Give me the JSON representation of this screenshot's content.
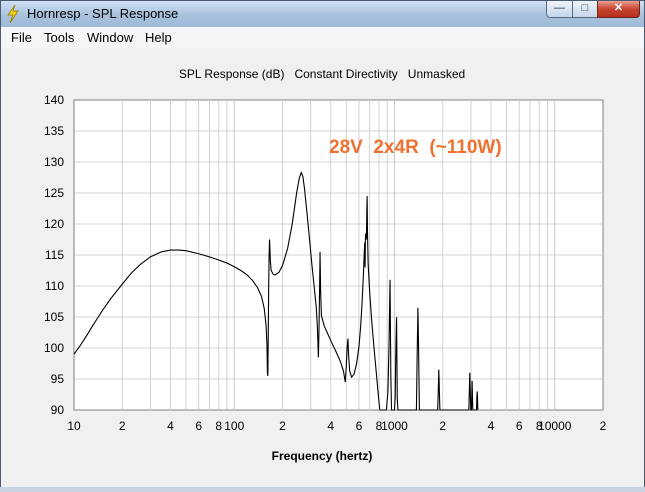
{
  "window": {
    "title": "Hornresp - SPL Response",
    "icon": "lightning-bolt-icon",
    "buttons": {
      "minimize": "—",
      "maximize": "□",
      "close": "✕"
    }
  },
  "menu": [
    {
      "label": "File"
    },
    {
      "label": "Tools"
    },
    {
      "label": "Window"
    },
    {
      "label": "Help"
    }
  ],
  "colors": {
    "annotation": "#f07030",
    "curve": "#000000",
    "grid": "#c8c8c8"
  },
  "chart_data": {
    "type": "line",
    "title": "SPL Response (dB)   Constant Directivity   Unmasked",
    "xlabel": "Frequency (hertz)",
    "ylabel": "",
    "xscale": "log",
    "xlim": [
      10,
      20000
    ],
    "ylim": [
      90,
      140
    ],
    "grid": true,
    "annotation": "28V  2x4R  (~110W)",
    "yticks": [
      140,
      135,
      130,
      125,
      120,
      115,
      110,
      105,
      100,
      95,
      90
    ],
    "xticks": [
      {
        "value": 10,
        "label": "10"
      },
      {
        "value": 20,
        "label": "2"
      },
      {
        "value": 40,
        "label": "4"
      },
      {
        "value": 60,
        "label": "6"
      },
      {
        "value": 80,
        "label": "8"
      },
      {
        "value": 100,
        "label": "100"
      },
      {
        "value": 200,
        "label": "2"
      },
      {
        "value": 400,
        "label": "4"
      },
      {
        "value": 600,
        "label": "6"
      },
      {
        "value": 800,
        "label": "8"
      },
      {
        "value": 1000,
        "label": "1000"
      },
      {
        "value": 2000,
        "label": "2"
      },
      {
        "value": 4000,
        "label": "4"
      },
      {
        "value": 6000,
        "label": "6"
      },
      {
        "value": 8000,
        "label": "8"
      },
      {
        "value": 10000,
        "label": "10000"
      },
      {
        "value": 20000,
        "label": "2"
      }
    ],
    "series": [
      {
        "values": [
          [
            10,
            99
          ],
          [
            11,
            100.5
          ],
          [
            12,
            102
          ],
          [
            13,
            103.5
          ],
          [
            14,
            104.8
          ],
          [
            15,
            106
          ],
          [
            17,
            108
          ],
          [
            20,
            110.3
          ],
          [
            23,
            112.2
          ],
          [
            26,
            113.5
          ],
          [
            30,
            114.7
          ],
          [
            35,
            115.5
          ],
          [
            40,
            115.8
          ],
          [
            45,
            115.8
          ],
          [
            50,
            115.7
          ],
          [
            60,
            115.2
          ],
          [
            70,
            114.7
          ],
          [
            80,
            114.2
          ],
          [
            90,
            113.7
          ],
          [
            100,
            113.1
          ],
          [
            110,
            112.5
          ],
          [
            120,
            111.8
          ],
          [
            130,
            110.9
          ],
          [
            140,
            109.7
          ],
          [
            148,
            108.3
          ],
          [
            154,
            106.3
          ],
          [
            158,
            103.6
          ],
          [
            160,
            100.5
          ],
          [
            161,
            96
          ],
          [
            162,
            95.5
          ],
          [
            163,
            102
          ],
          [
            164,
            110
          ],
          [
            165,
            115
          ],
          [
            166,
            117.5
          ],
          [
            167,
            116
          ],
          [
            168,
            114
          ],
          [
            170,
            112.5
          ],
          [
            175,
            111.9
          ],
          [
            180,
            111.8
          ],
          [
            190,
            112.2
          ],
          [
            200,
            113.3
          ],
          [
            215,
            116
          ],
          [
            230,
            120
          ],
          [
            245,
            125
          ],
          [
            255,
            127.5
          ],
          [
            262,
            128.3
          ],
          [
            268,
            127.7
          ],
          [
            275,
            125.5
          ],
          [
            285,
            121.5
          ],
          [
            295,
            117.5
          ],
          [
            305,
            113.5
          ],
          [
            315,
            110
          ],
          [
            325,
            106.5
          ],
          [
            330,
            103.5
          ],
          [
            335,
            98.5
          ],
          [
            338,
            103
          ],
          [
            341,
            110
          ],
          [
            343,
            115.5
          ],
          [
            346,
            109
          ],
          [
            350,
            105.2
          ],
          [
            365,
            103.5
          ],
          [
            380,
            102.5
          ],
          [
            400,
            101.2
          ],
          [
            430,
            99.5
          ],
          [
            460,
            97.8
          ],
          [
            480,
            96.3
          ],
          [
            493,
            94.5
          ],
          [
            500,
            97
          ],
          [
            506,
            100
          ],
          [
            512,
            101.5
          ],
          [
            518,
            98.5
          ],
          [
            525,
            96.3
          ],
          [
            540,
            95.3
          ],
          [
            560,
            95.8
          ],
          [
            580,
            97.5
          ],
          [
            600,
            100.2
          ],
          [
            615,
            103.5
          ],
          [
            628,
            107.5
          ],
          [
            640,
            112
          ],
          [
            648,
            115.5
          ],
          [
            652,
            117
          ],
          [
            655,
            113
          ],
          [
            658,
            117.5
          ],
          [
            662,
            118.5
          ],
          [
            668,
            117.5
          ],
          [
            672,
            122.5
          ],
          [
            675,
            124.5
          ],
          [
            678,
            119
          ],
          [
            685,
            113.5
          ],
          [
            700,
            109
          ],
          [
            720,
            104.5
          ],
          [
            745,
            100
          ],
          [
            770,
            96
          ],
          [
            795,
            92
          ],
          [
            810,
            90
          ],
          [
            890,
            90
          ],
          [
            910,
            93
          ],
          [
            925,
            101
          ],
          [
            938,
            111
          ],
          [
            948,
            96
          ],
          [
            958,
            90
          ],
          [
            1000,
            90
          ],
          [
            1010,
            92
          ],
          [
            1020,
            100
          ],
          [
            1030,
            105
          ],
          [
            1040,
            92
          ],
          [
            1050,
            90
          ],
          [
            1370,
            90
          ],
          [
            1385,
            99
          ],
          [
            1400,
            106.5
          ],
          [
            1415,
            99
          ],
          [
            1430,
            90
          ],
          [
            1860,
            90
          ],
          [
            1875,
            93
          ],
          [
            1890,
            96.5
          ],
          [
            1905,
            93
          ],
          [
            1920,
            90
          ],
          [
            2910,
            90
          ],
          [
            2930,
            93
          ],
          [
            2950,
            96
          ],
          [
            2970,
            93
          ],
          [
            2990,
            90
          ],
          [
            3020,
            90
          ],
          [
            3035,
            92
          ],
          [
            3050,
            94.7
          ],
          [
            3065,
            92
          ],
          [
            3080,
            90
          ],
          [
            3250,
            90
          ],
          [
            3265,
            92
          ],
          [
            3280,
            93
          ],
          [
            3295,
            92
          ],
          [
            3310,
            90
          ]
        ]
      }
    ]
  }
}
